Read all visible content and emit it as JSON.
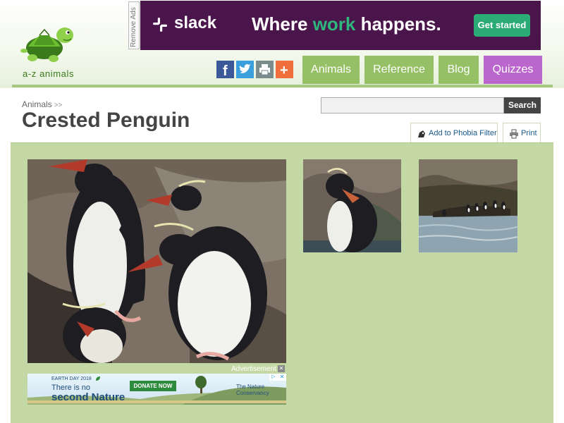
{
  "site": {
    "logo_text": "a-z animals"
  },
  "top_ad": {
    "remove_ads_label": "Remove Ads",
    "brand": "slack",
    "headline_before": "Where ",
    "headline_highlight": "work",
    "headline_after": " happens.",
    "cta_label": "Get started",
    "info_glyph": "▷",
    "close_glyph": "✕",
    "colors": {
      "background": "#4a154b",
      "highlight": "#2eb67d",
      "cta": "#2bac76"
    }
  },
  "share": {
    "facebook": {
      "glyph": "f",
      "color": "#3b5998"
    },
    "twitter": {
      "color": "#3a9fdc"
    },
    "print": {
      "color": "#7a8c8c"
    },
    "more": {
      "glyph": "+",
      "color": "#f06d3c"
    }
  },
  "nav": {
    "items": [
      {
        "label": "Animals",
        "color": "#96c065"
      },
      {
        "label": "Reference",
        "color": "#96c065"
      },
      {
        "label": "Blog",
        "color": "#96c065"
      },
      {
        "label": "Quizzes",
        "color": "#bb66cc"
      }
    ]
  },
  "breadcrumb": {
    "label": "Animals",
    "separator": ">>"
  },
  "page": {
    "title": "Crested Penguin"
  },
  "search": {
    "value": "",
    "button_label": "Search"
  },
  "tools": {
    "phobia_filter_label": "Add to Phobia Filter",
    "print_label": "Print"
  },
  "bottom_ad": {
    "label": "Advertisement",
    "close_glyph": "✕",
    "kicker": "EARTH DAY 2018",
    "line1": "There is no",
    "line2": "second Nature",
    "donate_label": "DONATE NOW",
    "brand_line1": "The Nature",
    "brand_line2": "Conservancy"
  },
  "colors": {
    "content_background": "#c4d8a5",
    "nav_rule": "#a6c77f",
    "title": "#444444",
    "search_button": "#444444"
  }
}
